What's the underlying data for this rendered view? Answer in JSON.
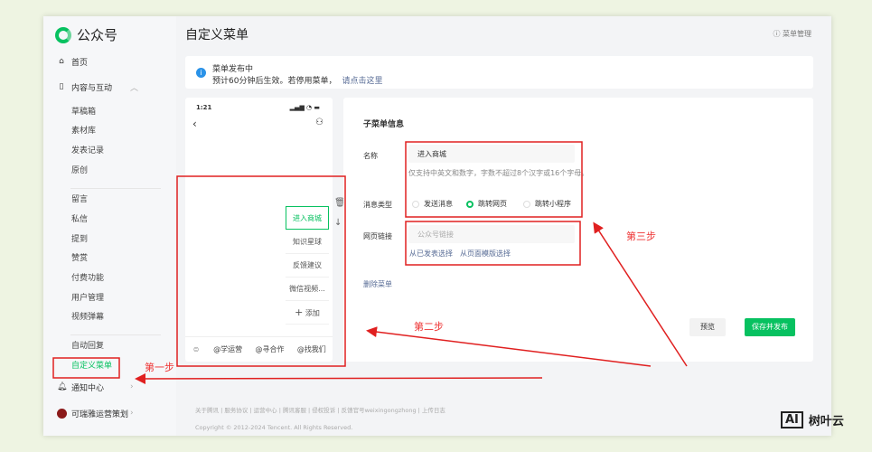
{
  "app": {
    "name": "公众号"
  },
  "sidebar": {
    "home": "首页",
    "content": "内容与互动",
    "group1": [
      "草稿箱",
      "素材库",
      "发表记录",
      "原创"
    ],
    "group2": [
      "留言",
      "私信",
      "提到",
      "赞赏",
      "付费功能",
      "用户管理",
      "视频弹幕"
    ],
    "group3": [
      "自动回复",
      "自定义菜单"
    ],
    "notify": "通知中心",
    "account": "可瑞雅运营策划"
  },
  "header": {
    "title": "自定义菜单",
    "manage": "菜单管理"
  },
  "notice": {
    "title": "菜单发布中",
    "text": "预计60分钟后生效。若停用菜单，",
    "link": "请点击这里"
  },
  "phone": {
    "time": "1:21",
    "submenu": [
      "进入商城",
      "知识星球",
      "反馈建议",
      "微信视频..."
    ],
    "add": "添加",
    "bar": [
      "@学运营",
      "@寻合作",
      "@找我们"
    ]
  },
  "form": {
    "heading": "子菜单信息",
    "name_label": "名称",
    "name_value": "进入商城",
    "name_hint": "仅支持中英文和数字，字数不超过8个汉字或16个字母。",
    "type_label": "消息类型",
    "types": [
      "发送消息",
      "跳转网页",
      "跳转小程序"
    ],
    "selected_type": "跳转网页",
    "url_label": "网页链接",
    "url_placeholder": "公众号链接",
    "pick_published": "从已发表选择",
    "pick_template": "从页面模版选择",
    "delete": "删除菜单",
    "preview": "预览",
    "save": "保存并发布"
  },
  "footer": {
    "links": "关于腾讯 | 服务协议 | 运营中心 | 腾讯客服 | 侵权投诉 | 反馈官号weixingongzhong | 上传日志",
    "copyright": "Copyright © 2012-2024 Tencent. All Rights Reserved."
  },
  "annotations": {
    "step1": "第一步",
    "step2": "第二步",
    "step3": "第三步",
    "color": "#e02020"
  },
  "watermark": {
    "logo": "AI",
    "name": "树叶云"
  },
  "colors": {
    "accent": "#07c160",
    "link": "#576b95"
  }
}
